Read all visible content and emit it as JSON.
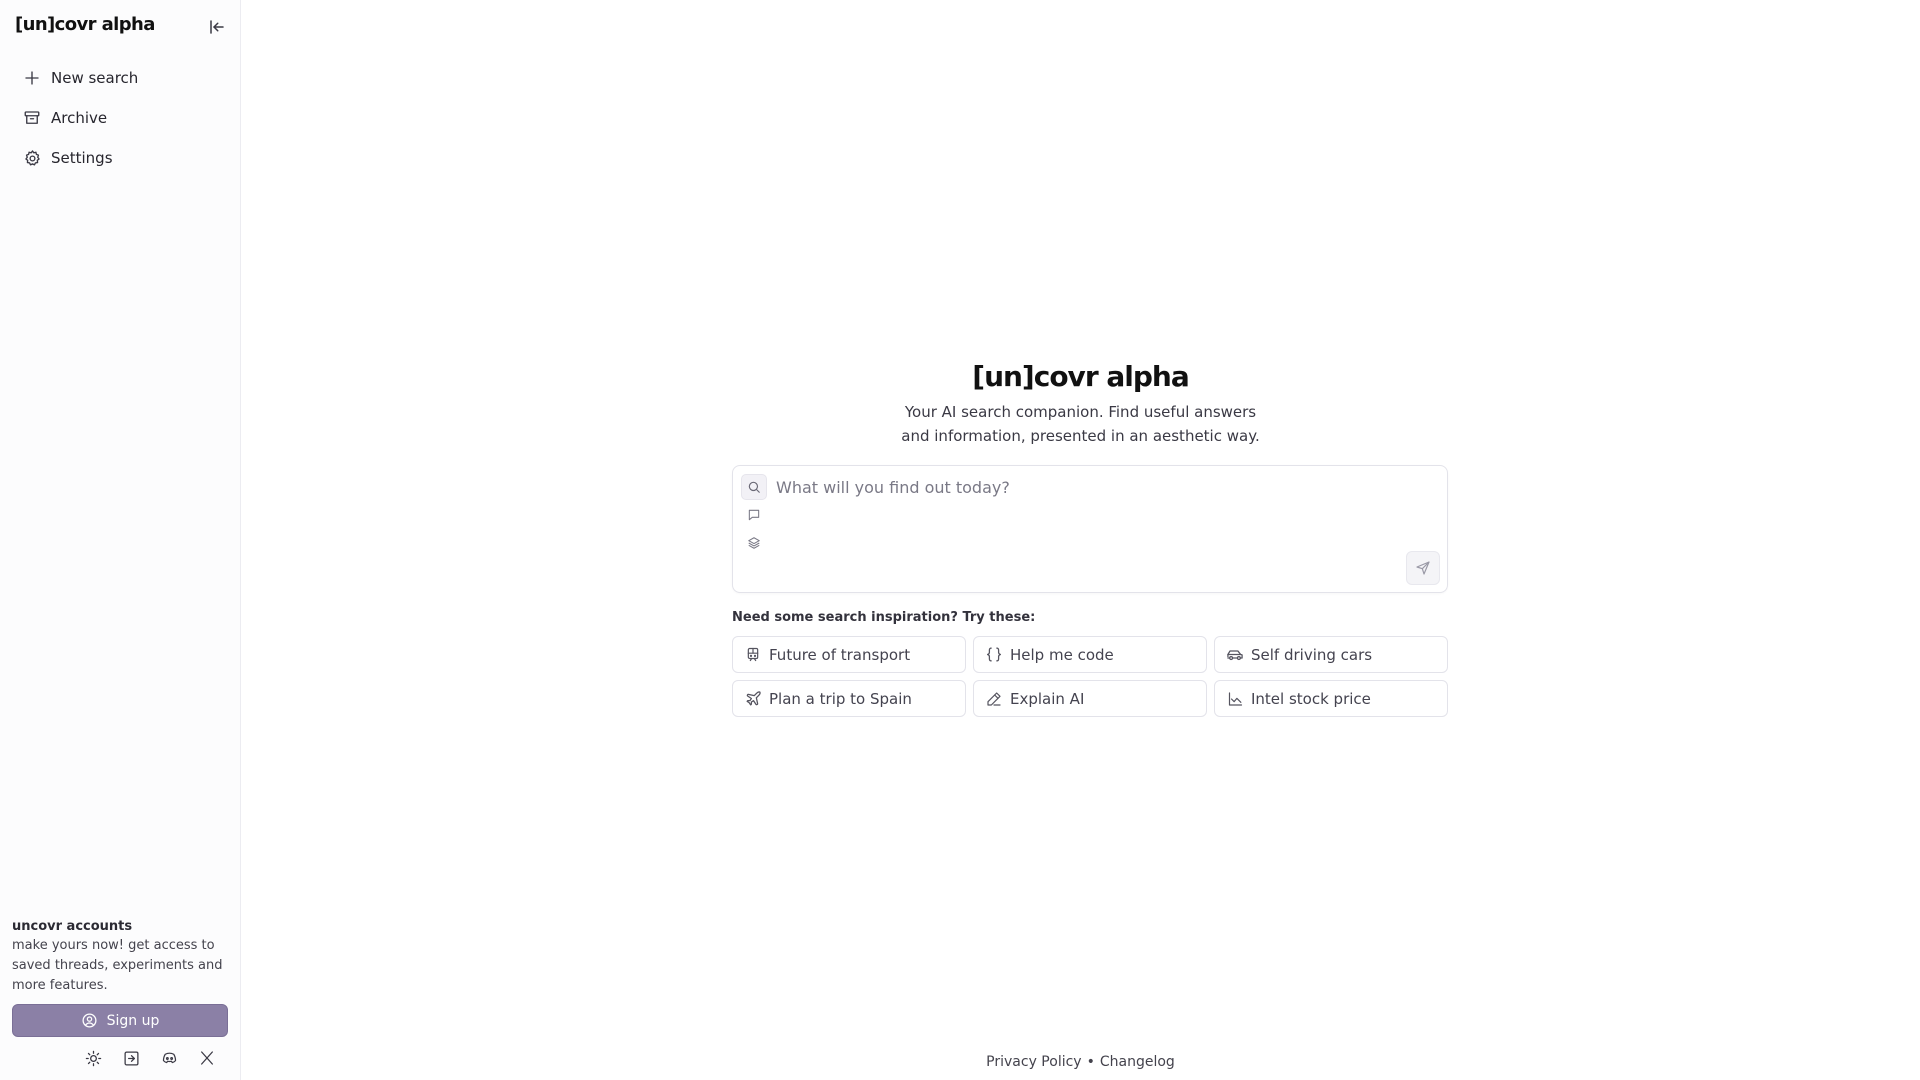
{
  "app": {
    "logo_text": "[un]covr alpha"
  },
  "sidebar": {
    "items": [
      {
        "label": "New search",
        "icon": "plus-icon"
      },
      {
        "label": "Archive",
        "icon": "archive-icon"
      },
      {
        "label": "Settings",
        "icon": "gear-icon"
      }
    ],
    "accounts": {
      "title": "uncovr accounts",
      "text": "make yours now! get access to saved threads, experiments and more features."
    },
    "signup_label": "Sign up",
    "footer_icons": [
      "sun-icon",
      "login-icon",
      "discord-icon",
      "x-icon"
    ]
  },
  "main": {
    "logo_text": "[un]covr alpha",
    "tagline": "Your AI search companion. Find useful answers and information, presented in an aesthetic way.",
    "search": {
      "placeholder": "What will you find out today?"
    },
    "inspiration_label": "Need some search inspiration? Try these:",
    "suggestions": [
      {
        "label": "Future of transport",
        "icon": "train-icon"
      },
      {
        "label": "Help me code",
        "icon": "braces-icon"
      },
      {
        "label": "Self driving cars",
        "icon": "car-icon"
      },
      {
        "label": "Plan a trip to Spain",
        "icon": "plane-icon"
      },
      {
        "label": "Explain AI",
        "icon": "pencil-icon"
      },
      {
        "label": "Intel stock price",
        "icon": "chart-icon"
      }
    ]
  },
  "footer": {
    "privacy": "Privacy Policy",
    "separator": "•",
    "changelog": "Changelog"
  },
  "colors": {
    "accent": "#8b80a6",
    "border": "#e3e3ea",
    "text": "#1c1b22"
  }
}
